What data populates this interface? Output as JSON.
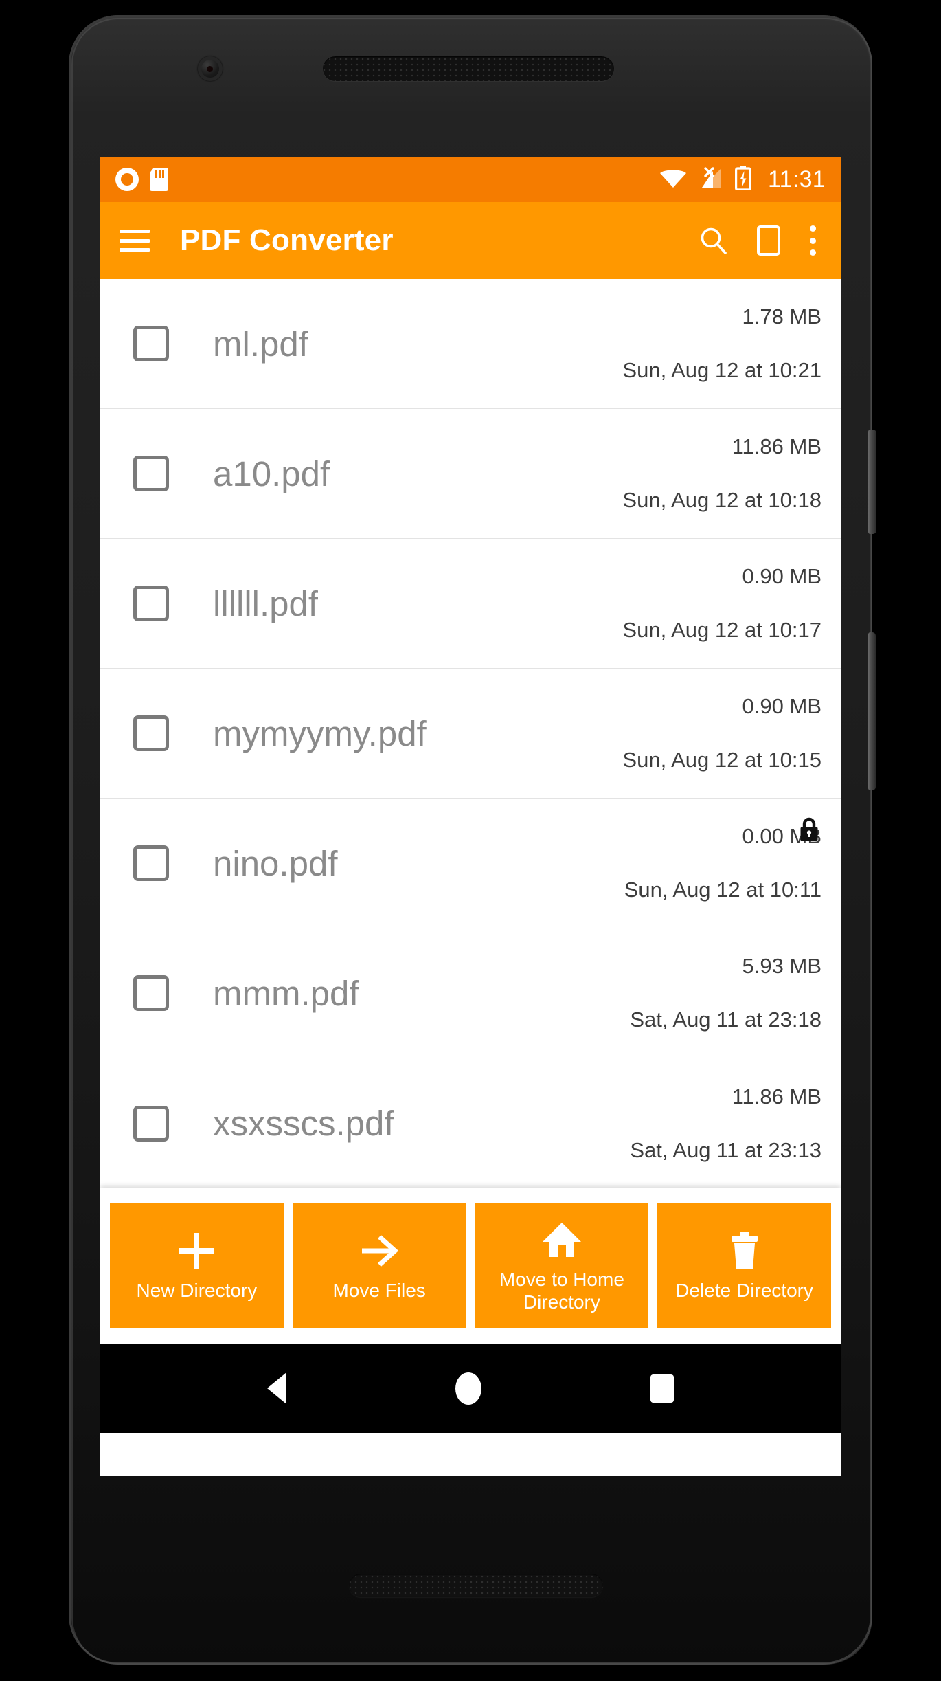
{
  "device": {
    "frame_name": "android-phone-frame"
  },
  "status_bar": {
    "left_icons": [
      "record-icon",
      "sd-card-icon"
    ],
    "right_icons": [
      "wifi-icon",
      "no-sim-signal-icon",
      "battery-charging-icon"
    ],
    "time": "11:31",
    "background": "#F57C00"
  },
  "app_bar": {
    "menu_icon": "hamburger-menu-icon",
    "title": "PDF Converter",
    "actions": [
      {
        "icon": "search-icon",
        "label": "Search"
      },
      {
        "icon": "document-outline-icon",
        "label": "Select Document"
      },
      {
        "icon": "overflow-menu-icon",
        "label": "More options"
      }
    ],
    "background": "#FF9800"
  },
  "file_list": {
    "rows": [
      {
        "name": "ml.pdf",
        "size": "1.78 MB",
        "date": "Sun, Aug 12 at 10:21",
        "checked": false,
        "locked": false
      },
      {
        "name": "a10.pdf",
        "size": "11.86 MB",
        "date": "Sun, Aug 12 at 10:18",
        "checked": false,
        "locked": false
      },
      {
        "name": "llllll.pdf",
        "size": "0.90 MB",
        "date": "Sun, Aug 12 at 10:17",
        "checked": false,
        "locked": false
      },
      {
        "name": "mymyymy.pdf",
        "size": "0.90 MB",
        "date": "Sun, Aug 12 at 10:15",
        "checked": false,
        "locked": false
      },
      {
        "name": "nino.pdf",
        "size": "0.00 MB",
        "date": "Sun, Aug 12 at 10:11",
        "checked": false,
        "locked": true
      },
      {
        "name": "mmm.pdf",
        "size": "5.93 MB",
        "date": "Sat, Aug 11 at 23:18",
        "checked": false,
        "locked": false
      },
      {
        "name": "xsxsscs.pdf",
        "size": "11.86 MB",
        "date": "Sat, Aug 11 at 23:13",
        "checked": false,
        "locked": false
      }
    ]
  },
  "bottom_actions": {
    "buttons": [
      {
        "label": "New Directory",
        "icon": "plus-icon"
      },
      {
        "label": "Move Files",
        "icon": "arrow-right-icon"
      },
      {
        "label": "Move to Home Directory",
        "icon": "home-icon"
      },
      {
        "label": "Delete Directory",
        "icon": "trash-icon"
      }
    ],
    "background": "#FF9800"
  },
  "nav_bar": {
    "buttons": [
      {
        "icon": "back-triangle-icon",
        "label": "Back"
      },
      {
        "icon": "home-circle-icon",
        "label": "Home"
      },
      {
        "icon": "recents-square-icon",
        "label": "Recents"
      }
    ]
  }
}
